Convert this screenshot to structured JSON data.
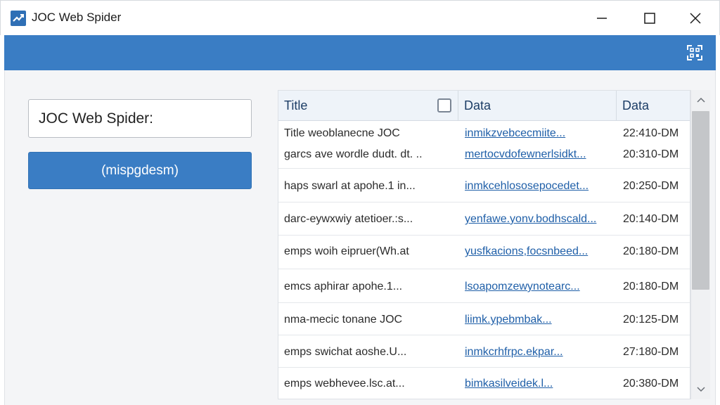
{
  "window": {
    "title": "JOC Web Spider",
    "buttons": [
      "minimize",
      "maximize",
      "close"
    ]
  },
  "ribbon": {
    "icon": "qr-scan-icon"
  },
  "form": {
    "url_value": "JOC Web Spider:",
    "start_button_label": "(mispgdesm)"
  },
  "table": {
    "columns": [
      "Title",
      "Data",
      "Data"
    ],
    "rows": [
      {
        "title": "Title weoblanecne JOC",
        "data": "inmikzvebcecmiite...",
        "time": "22:410-DM"
      },
      {
        "title": "garcs ave wordle dudt. dt. ..",
        "data": "mertocvdofewnerlsidkt...",
        "time": "20:310-DM"
      },
      {
        "title": "haps swarl at apohe.1 in...",
        "data": "inmkcehlososepocedet...",
        "time": "20:250-DM"
      },
      {
        "title": "darc-eywxwiy atetioer.:s...",
        "data": "yenfawe.yonv.bodhscald...",
        "time": "20:140-DM"
      },
      {
        "title": "emps woih eipruer(Wh.at",
        "data": "yusfkacions,focsnbeed...",
        "time": "20:180-DM"
      },
      {
        "title": "emcs aphirar apohe.1...",
        "data": "lsoapomzewynotearc...",
        "time": "20:180-DM"
      },
      {
        "title": "nma-mecic tonane JOC",
        "data": "liimk.ypebmbak...",
        "time": "20:125-DM"
      },
      {
        "title": "emps swichat aoshe.U...",
        "data": "inmkcrhfrpc.ekpar...",
        "time": "27:180-DM"
      },
      {
        "title": "emps webhevee.lsc.at...",
        "data": "bimkasilveidek.l...",
        "time": "20:380-DM"
      }
    ]
  },
  "colors": {
    "accent": "#3a7dc4",
    "link": "#1f5fa8",
    "header_bg": "#eef3f9"
  }
}
